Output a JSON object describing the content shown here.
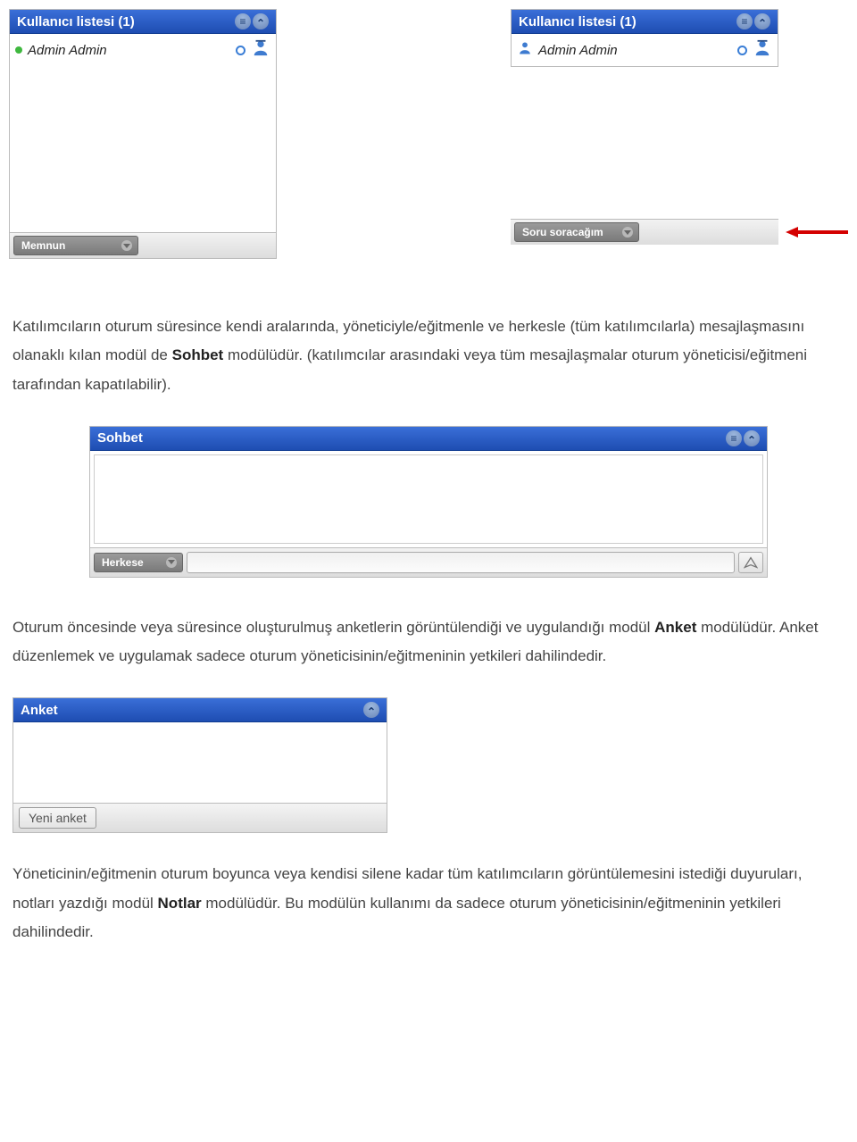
{
  "userlist_left": {
    "title": "Kullanıcı listesi (1)",
    "user_name": "Admin Admin",
    "status_label": "Memnun"
  },
  "userlist_right": {
    "title": "Kullanıcı listesi (1)",
    "user_name": "Admin Admin",
    "status_label": "Soru soracağım"
  },
  "para1": {
    "pre": "Katılımcıların oturum süresince kendi aralarında, yöneticiyle/eğitmenle ve herkesle (tüm katılımcılarla) mesajlaşmasını olanaklı kılan modül de ",
    "bold": "Sohbet",
    "post": " modülüdür. (katılımcılar arasındaki veya tüm mesajlaşmalar oturum yöneticisi/eğitmeni tarafından kapatılabilir)."
  },
  "sohbet": {
    "title": "Sohbet",
    "target_label": "Herkese"
  },
  "para2": {
    "pre": "Oturum öncesinde veya süresince oluşturulmuş anketlerin görüntülendiği ve uygulandığı modül ",
    "bold": "Anket",
    "post": " modülüdür. Anket düzenlemek ve uygulamak sadece oturum yöneticisinin/eğitmeninin yetkileri dahilindedir."
  },
  "anket": {
    "title": "Anket",
    "new_button": "Yeni anket"
  },
  "para3": {
    "pre": "Yöneticinin/eğitmenin oturum boyunca veya kendisi silene kadar tüm katılımcıların görüntülemesini istediği duyuruları, notları yazdığı modül ",
    "bold": "Notlar",
    "post": " modülüdür. Bu modülün kullanımı da sadece oturum yöneticisinin/eğitmeninin yetkileri dahilindedir."
  }
}
